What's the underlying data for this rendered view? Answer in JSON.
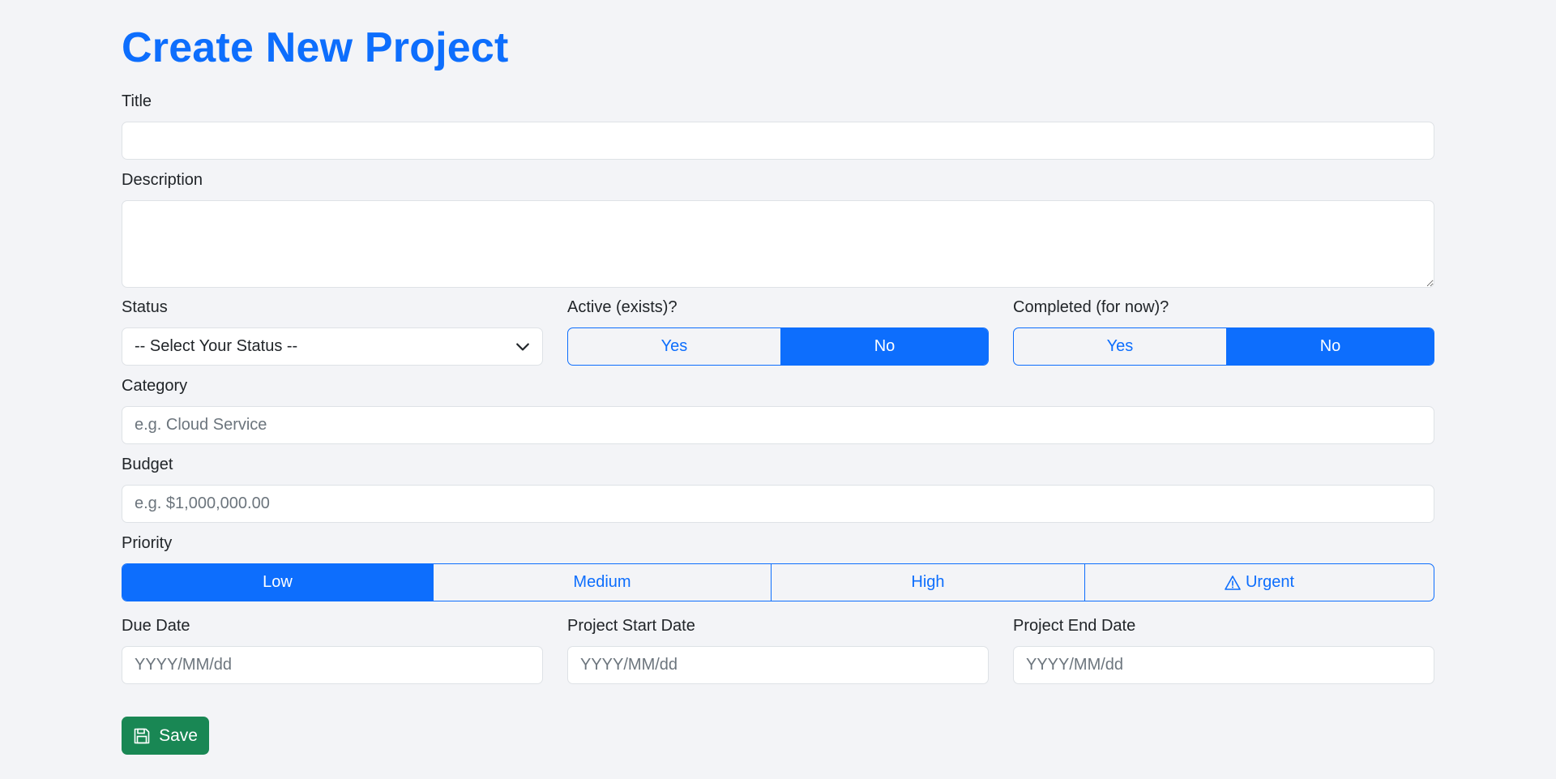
{
  "page": {
    "title": "Create New Project"
  },
  "form": {
    "title_label": "Title",
    "title_value": "",
    "description_label": "Description",
    "description_value": "",
    "status_label": "Status",
    "status_selected": "-- Select Your Status --",
    "active_label": "Active (exists)?",
    "active_options": [
      "Yes",
      "No"
    ],
    "active_selected": "No",
    "completed_label": "Completed (for now)?",
    "completed_options": [
      "Yes",
      "No"
    ],
    "completed_selected": "No",
    "category_label": "Category",
    "category_placeholder": "e.g. Cloud Service",
    "budget_label": "Budget",
    "budget_placeholder": "e.g. $1,000,000.00",
    "priority_label": "Priority",
    "priority_options": [
      "Low",
      "Medium",
      "High",
      "Urgent"
    ],
    "priority_selected": "Low",
    "due_date_label": "Due Date",
    "due_date_placeholder": "YYYY/MM/dd",
    "start_date_label": "Project Start Date",
    "start_date_placeholder": "YYYY/MM/dd",
    "end_date_label": "Project End Date",
    "end_date_placeholder": "YYYY/MM/dd",
    "save_label": "Save"
  },
  "icons": {
    "select_chevron": "chevron-down-icon",
    "urgent": "warning-triangle-icon",
    "save": "floppy-disk-icon"
  },
  "colors": {
    "primary": "#0d6efd",
    "success": "#198754",
    "background": "#f3f4f7"
  }
}
